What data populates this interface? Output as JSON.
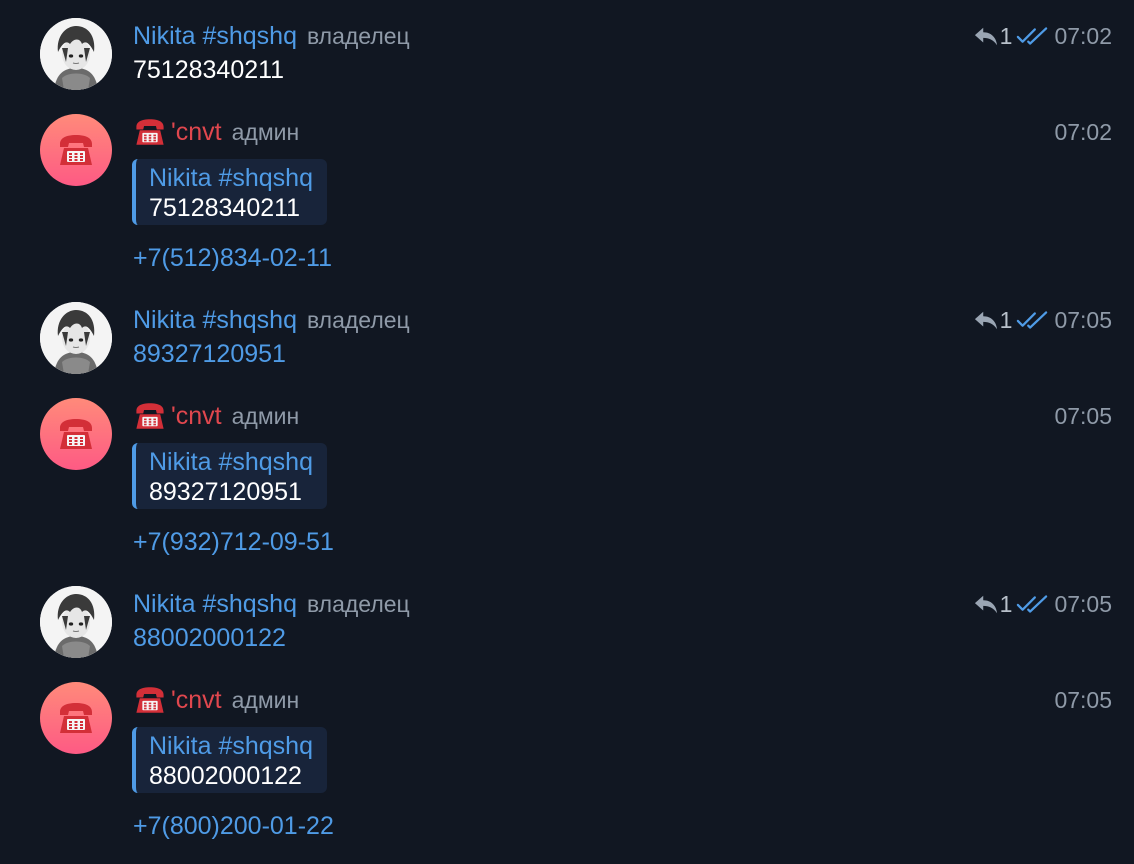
{
  "colors": {
    "background": "#111722",
    "link_blue": "#4f9be6",
    "admin_red": "#e0474e",
    "muted": "#8f9aa8",
    "quote_bg": "#18243a"
  },
  "messages": [
    {
      "author": "Nikita #shqshq",
      "role": "владелец",
      "reply_count": "1",
      "time": "07:02",
      "text": "75128340211"
    },
    {
      "author_emoji": "☎️",
      "author": "'cnvt",
      "role": "админ",
      "time": "07:02",
      "quote_author": "Nikita #shqshq",
      "quote_text": "75128340211",
      "text": "+7(512)834-02-11"
    },
    {
      "author": "Nikita #shqshq",
      "role": "владелец",
      "reply_count": "1",
      "time": "07:05",
      "text": "89327120951"
    },
    {
      "author_emoji": "☎️",
      "author": "'cnvt",
      "role": "админ",
      "time": "07:05",
      "quote_author": "Nikita #shqshq",
      "quote_text": "89327120951",
      "text": "+7(932)712-09-51"
    },
    {
      "author": "Nikita #shqshq",
      "role": "владелец",
      "reply_count": "1",
      "time": "07:05",
      "text": "88002000122"
    },
    {
      "author_emoji": "☎️",
      "author": "'cnvt",
      "role": "админ",
      "time": "07:05",
      "quote_author": "Nikita #shqshq",
      "quote_text": "88002000122",
      "text": "+7(800)200-01-22"
    }
  ]
}
